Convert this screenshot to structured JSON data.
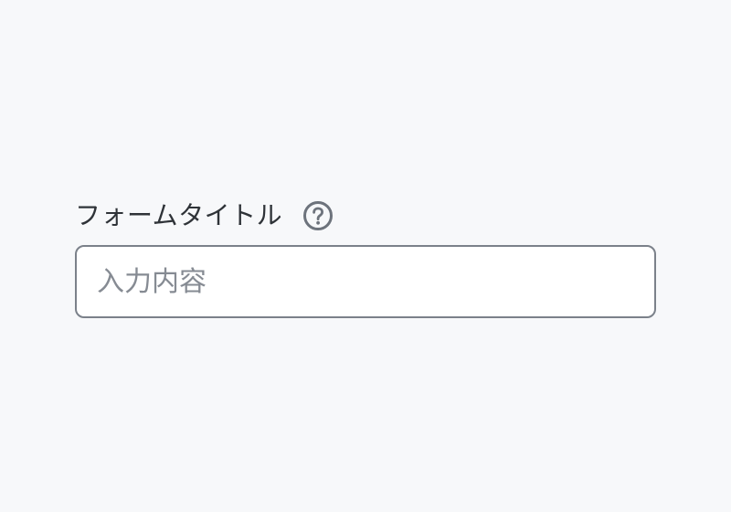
{
  "form": {
    "label": "フォームタイトル",
    "help_icon": "question-circle-icon",
    "input": {
      "value": "",
      "placeholder": "入力内容"
    }
  },
  "colors": {
    "background": "#f7f8fa",
    "label_text": "#2f3338",
    "icon": "#6d737c",
    "input_border": "#7b818a",
    "placeholder": "#868b93"
  }
}
